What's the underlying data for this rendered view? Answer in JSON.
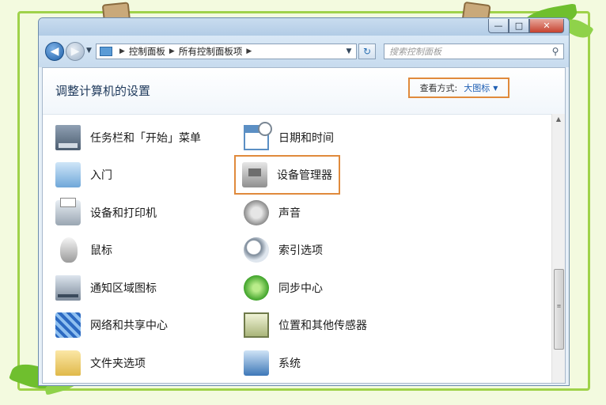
{
  "window": {
    "minimize": "—",
    "maximize": "□",
    "close": "✕"
  },
  "nav": {
    "breadcrumb": [
      "控制面板",
      "所有控制面板项"
    ],
    "search_placeholder": "搜索控制面板"
  },
  "content": {
    "title": "调整计算机的设置",
    "view_label": "查看方式:",
    "view_value": "大图标"
  },
  "items": {
    "left": [
      {
        "label": "任务栏和「开始」菜单",
        "icon": "taskbar-icon"
      },
      {
        "label": "入门",
        "icon": "getting-started-icon"
      },
      {
        "label": "设备和打印机",
        "icon": "printer-icon"
      },
      {
        "label": "鼠标",
        "icon": "mouse-icon"
      },
      {
        "label": "通知区域图标",
        "icon": "notification-area-icon"
      },
      {
        "label": "网络和共享中心",
        "icon": "network-icon"
      },
      {
        "label": "文件夹选项",
        "icon": "folder-icon"
      }
    ],
    "right": [
      {
        "label": "日期和时间",
        "icon": "calendar-clock-icon"
      },
      {
        "label": "设备管理器",
        "icon": "device-manager-icon"
      },
      {
        "label": "声音",
        "icon": "speaker-icon"
      },
      {
        "label": "索引选项",
        "icon": "index-search-icon"
      },
      {
        "label": "同步中心",
        "icon": "sync-icon"
      },
      {
        "label": "位置和其他传感器",
        "icon": "sensor-icon"
      },
      {
        "label": "系统",
        "icon": "system-icon"
      }
    ]
  },
  "colors": {
    "highlight": "#e08a3c",
    "link": "#1f5fb3",
    "frame_green": "#9fd24a"
  }
}
